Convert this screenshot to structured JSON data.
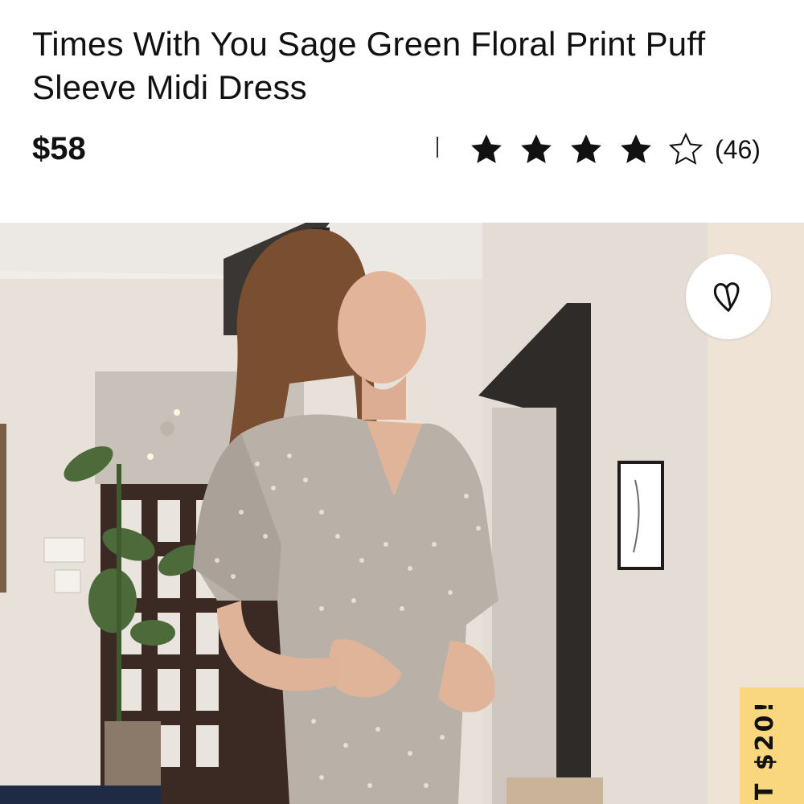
{
  "product": {
    "title": "Times With You Sage Green Floral Print Puff Sleeve Midi Dress",
    "price": "$58",
    "rating": {
      "value": 4,
      "max": 5,
      "count_label": "(46)"
    }
  },
  "favorite": {
    "icon": "heart-icon"
  },
  "promo_tab": {
    "label": "T $20!"
  },
  "colors": {
    "promo": "#f8d77e",
    "star": "#111111"
  }
}
